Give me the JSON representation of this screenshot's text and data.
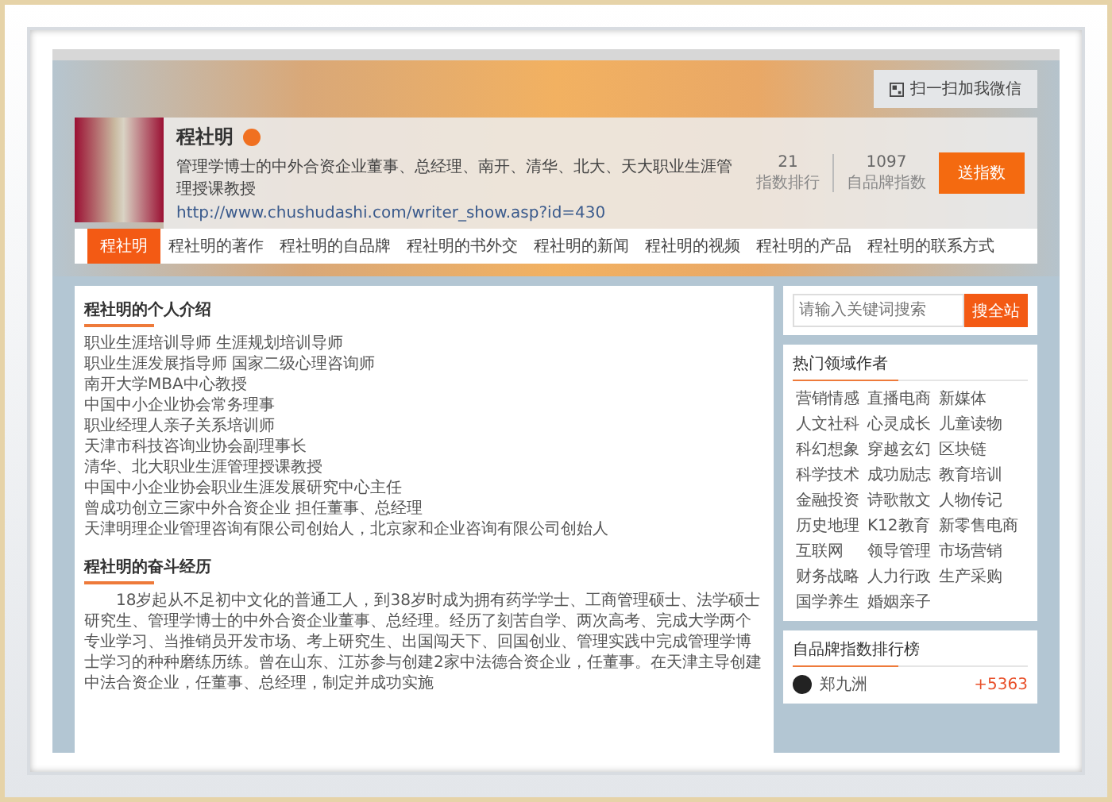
{
  "banner": {
    "qr_button": "扫一扫加我微信"
  },
  "profile": {
    "name": "程社明",
    "bio": "管理学博士的中外合资企业董事、总经理、南开、清华、北大、天大职业生涯管理授课教授",
    "url": "http://www.chushudashi.com/writer_show.asp?id=430",
    "stats": [
      {
        "value": "21",
        "label": "指数排行"
      },
      {
        "value": "1097",
        "label": "自品牌指数"
      }
    ],
    "action_button": "送指数"
  },
  "tabs": [
    {
      "label": "程社明",
      "selected": true
    },
    {
      "label": "程社明的著作",
      "selected": false
    },
    {
      "label": "程社明的自品牌",
      "selected": false
    },
    {
      "label": "程社明的书外交",
      "selected": false
    },
    {
      "label": "程社明的新闻",
      "selected": false
    },
    {
      "label": "程社明的视频",
      "selected": false
    },
    {
      "label": "程社明的产品",
      "selected": false
    },
    {
      "label": "程社明的联系方式",
      "selected": false
    }
  ],
  "intro": {
    "title": "程社明的个人介绍",
    "lines": [
      "职业生涯培训导师 生涯规划培训导师",
      "职业生涯发展指导师 国家二级心理咨询师",
      "南开大学MBA中心教授",
      "中国中小企业协会常务理事",
      "职业经理人亲子关系培训师",
      "天津市科技咨询业协会副理事长",
      "清华、北大职业生涯管理授课教授",
      "中国中小企业协会职业生涯发展研究中心主任",
      "曾成功创立三家中外合资企业 担任董事、总经理",
      "天津明理企业管理咨询有限公司创始人，北京家和企业咨询有限公司创始人"
    ]
  },
  "history": {
    "title": "程社明的奋斗经历",
    "paragraph": "18岁起从不足初中文化的普通工人，到38岁时成为拥有药学学士、工商管理硕士、法学硕士研究生、管理学博士的中外合资企业董事、总经理。经历了刻苦自学、两次高考、完成大学两个专业学习、当推销员开发市场、考上研究生、出国闯天下、回国创业、管理实践中完成管理学博士学习的种种磨练历练。曾在山东、江苏参与创建2家中法德合资企业，任董事。在天津主导创建中法合资企业，任董事、总经理，制定并成功实施"
  },
  "search": {
    "placeholder": "请输入关键词搜索",
    "button": "搜全站"
  },
  "hot_authors": {
    "title": "热门领域作者",
    "tags": [
      "营销情感",
      "直播电商",
      "新媒体",
      "人文社科",
      "心灵成长",
      "儿童读物",
      "科幻想象",
      "穿越玄幻",
      "区块链",
      "科学技术",
      "成功励志",
      "教育培训",
      "金融投资",
      "诗歌散文",
      "人物传记",
      "历史地理",
      "K12教育",
      "新零售电商",
      "互联网",
      "领导管理",
      "市场营销",
      "财务战略",
      "人力行政",
      "生产采购",
      "国学养生",
      "婚姻亲子"
    ]
  },
  "ranking": {
    "title": "自品牌指数排行榜",
    "rows": [
      {
        "name": "郑九洲",
        "score": "+5363"
      }
    ]
  }
}
